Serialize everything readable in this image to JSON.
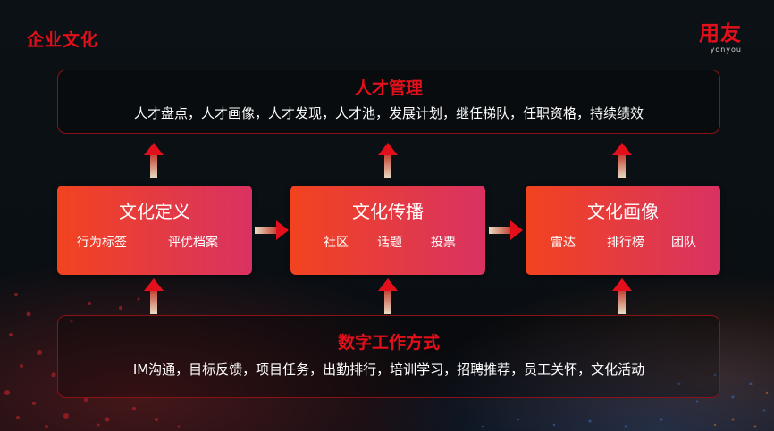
{
  "header": {
    "title": "企业文化",
    "logo_text": "用友",
    "logo_sub": "yonyou"
  },
  "top_panel": {
    "title": "人才管理",
    "items": "人才盘点，人才画像，人才发现，人才池，发展计划，继任梯队，任职资格，持续绩效"
  },
  "boxes": [
    {
      "title": "文化定义",
      "tags": [
        "行为标签",
        "评优档案"
      ]
    },
    {
      "title": "文化传播",
      "tags": [
        "社区",
        "话题",
        "投票"
      ]
    },
    {
      "title": "文化画像",
      "tags": [
        "雷达",
        "排行榜",
        "团队"
      ]
    }
  ],
  "bottom_panel": {
    "title": "数字工作方式",
    "items": "IM沟通，目标反馈，项目任务，出勤排行，培训学习，招聘推荐，员工关怀，文化活动"
  },
  "colors": {
    "brand_red": "#e3101b",
    "box_gradient_start": "#f2431f",
    "box_gradient_end": "#d93262",
    "arrow_red": "#e3101b",
    "arrow_tail": "#e9dcc4"
  }
}
